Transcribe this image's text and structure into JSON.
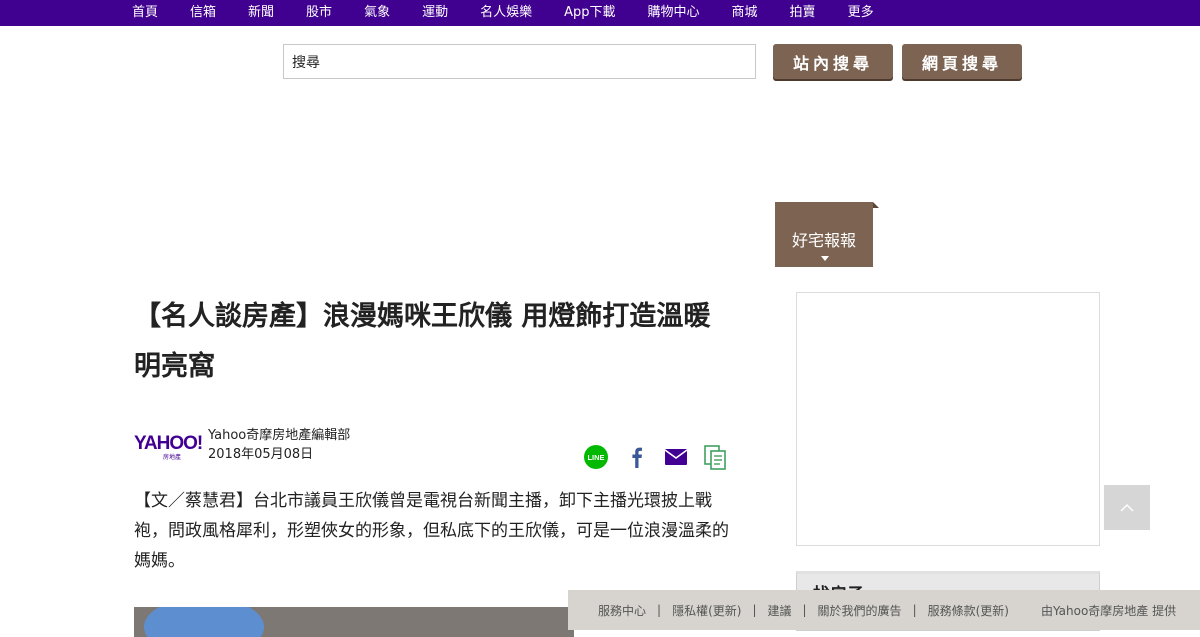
{
  "nav": {
    "items": [
      "首頁",
      "信箱",
      "新聞",
      "股市",
      "氣象",
      "運動",
      "名人娛樂",
      "App下載",
      "購物中心",
      "商城",
      "拍賣",
      "更多"
    ]
  },
  "search": {
    "value": "搜尋",
    "site_button": "站內搜尋",
    "web_button": "網頁搜尋"
  },
  "tag": {
    "label": "好宅報報"
  },
  "article": {
    "headline": "【名人談房產】浪漫媽咪王欣儀 用燈飾打造溫暖明亮窩",
    "logo": "YAHOO!",
    "logo_sub": "房地產",
    "author": "Yahoo奇摩房地產編輯部",
    "date": "2018年05月08日",
    "body": "【文／蔡慧君】台北市議員王欣儀曾是電視台新聞主播，卸下主播光環披上戰袍，問政風格犀利，形塑俠女的形象，但私底下的王欣儀，可是一位浪漫溫柔的媽媽。"
  },
  "share": {
    "icons": [
      "line-icon",
      "facebook-icon",
      "mail-icon",
      "copy-link-icon"
    ],
    "line_color": "#00b900",
    "facebook_color": "#3b5998",
    "mail_color": "#410093",
    "copy_color": "#40a060"
  },
  "sidebar": {
    "module_title": "找房子"
  },
  "footer": {
    "links": [
      "服務中心",
      "隱私權(更新)",
      "建議",
      "關於我們的廣告",
      "服務條款(更新)"
    ],
    "separator": "|",
    "provider": "由Yahoo奇摩房地產 提供"
  },
  "colors": {
    "nav_bg": "#400090",
    "button_bg": "#7c6352",
    "footer_bg": "#d7d4cf"
  }
}
